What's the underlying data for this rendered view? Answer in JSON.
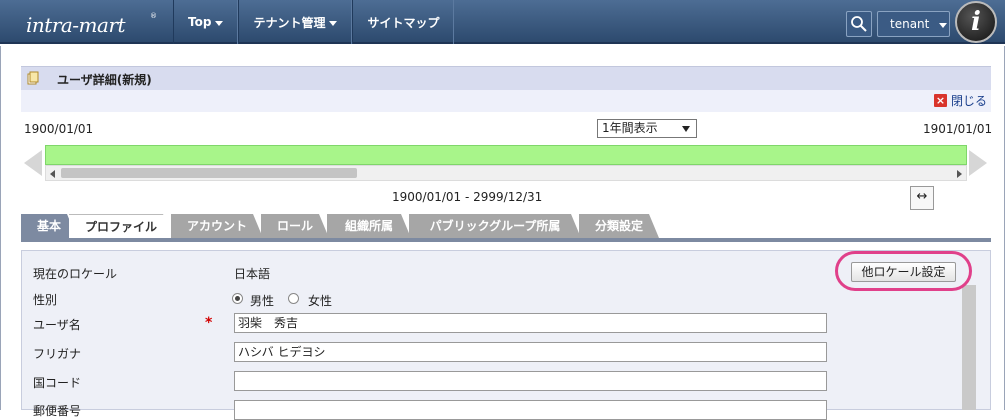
{
  "header": {
    "logo_text": "intra-mart",
    "logo_reg": "®",
    "nav": [
      "Top",
      "テナント管理",
      "サイトマップ"
    ],
    "tenant_label": "tenant",
    "avatar_letter": "i"
  },
  "page": {
    "title": "ユーザ詳細(新規)",
    "close_label": "閉じる"
  },
  "timeline": {
    "start_date": "1900/01/01",
    "end_date": "1901/01/01",
    "period_select": "1年間表示",
    "range": "1900/01/01 - 2999/12/31",
    "expand_icon": "↔"
  },
  "tabs": [
    "基本",
    "プロファイル",
    "アカウント",
    "ロール",
    "組織所属",
    "パブリックグループ所属",
    "分類設定"
  ],
  "active_tab": "プロファイル",
  "form": {
    "locale_label": "現在のロケール",
    "locale_value": "日本語",
    "other_locale_button": "他ロケール設定",
    "gender_label": "性別",
    "gender_male": "男性",
    "gender_female": "女性",
    "user_name_label": "ユーザ名",
    "required_mark": "*",
    "user_name_value": "羽柴　秀吉",
    "kana_label": "フリガナ",
    "kana_value": "ハシバ ヒデヨシ",
    "country_label": "国コード",
    "country_value": "",
    "postal_label": "郵便番号",
    "postal_value": ""
  },
  "colors": {
    "header_bg": "#3b5b84",
    "timeline_bar": "#a8f58a",
    "highlight": "#e0408a",
    "required": "#d20000"
  }
}
